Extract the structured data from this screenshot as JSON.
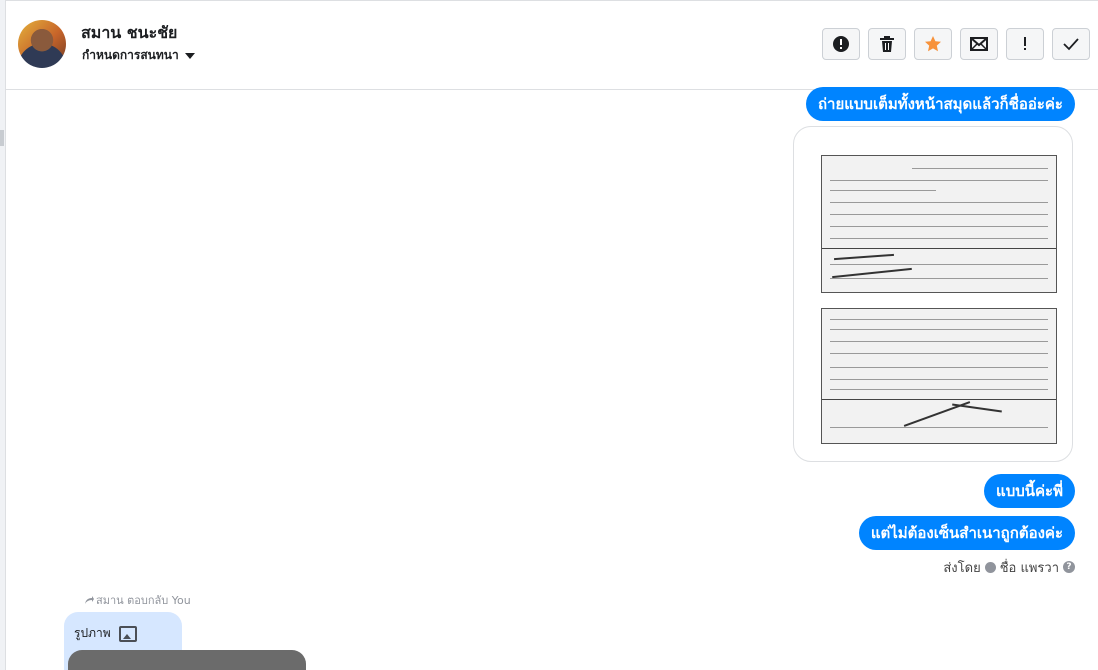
{
  "header": {
    "contact_name": "สมาน ชนะชัย",
    "assign_label": "กำหนดการสนทนา"
  },
  "toolbar": [
    {
      "icon": "alert-circle-icon",
      "name": "spam-button"
    },
    {
      "icon": "trash-icon",
      "name": "delete-button"
    },
    {
      "icon": "star-icon",
      "name": "follow-up-button",
      "color": "#f7923b"
    },
    {
      "icon": "envelope-icon",
      "name": "mark-unread-button"
    },
    {
      "icon": "exclamation-icon",
      "name": "priority-button"
    },
    {
      "icon": "check-icon",
      "name": "done-button"
    }
  ],
  "messages": {
    "outgoing_1": "ถ่ายแบบเต็มทั้งหน้าสมุดแล้วก็ชื่ออ่ะค่ะ",
    "outgoing_2": "แบบนี้ค่ะพี่",
    "outgoing_3": "แต่ไม่ต้องเซ็นสำเนาถูกต้องค่ะ",
    "sent_by_prefix": "ส่งโดย",
    "sent_by_name": "ชื่อ แพรวา",
    "reply_label": "สมาน ตอบกลับ You",
    "incoming_1": "รูปภาพ"
  },
  "colors": {
    "accent": "#0084ff",
    "incoming_bubble": "#d6e7ff",
    "star": "#f7923b"
  }
}
